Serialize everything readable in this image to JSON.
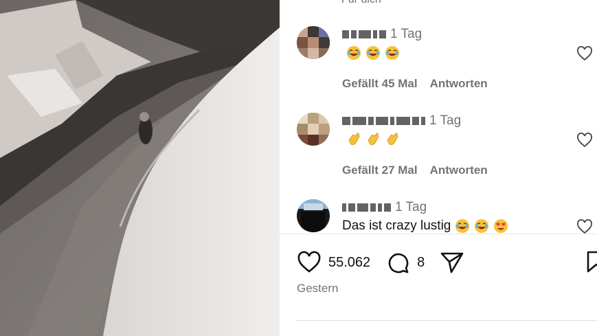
{
  "feed": {
    "top_cut_text": "Für dich"
  },
  "comments": [
    {
      "time": "1 Tag",
      "text": "",
      "emojis": [
        "laughing",
        "laughing",
        "laughing"
      ],
      "likes_label": "Gefällt 45 Mal",
      "reply_label": "Antworten"
    },
    {
      "time": "1 Tag",
      "text": "",
      "emojis": [
        "clapping",
        "clapping",
        "clapping"
      ],
      "likes_label": "Gefällt 27 Mal",
      "reply_label": "Antworten"
    },
    {
      "time": "1 Tag",
      "text": "Das ist crazy lustig",
      "emojis": [
        "laughing",
        "laughing",
        "heart-eyes"
      ]
    }
  ],
  "post": {
    "likes": "55.062",
    "comments": "8",
    "date": "Gestern"
  },
  "colors": {
    "muted_text": "#737373",
    "emoji_yellow": "#f7c23b"
  }
}
